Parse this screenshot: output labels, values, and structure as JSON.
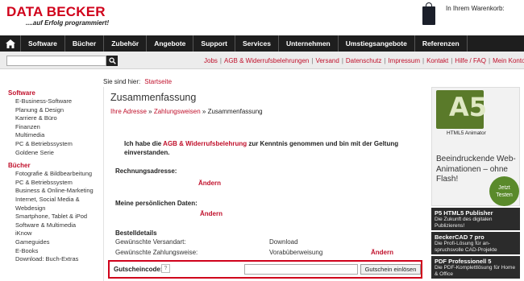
{
  "logo": {
    "brand": "DATA BECKER",
    "tagline": "....auf Erfolg programmiert!"
  },
  "cart": {
    "label": "In Ihrem Warenkorb:"
  },
  "nav": {
    "items": [
      "Software",
      "Bücher",
      "Zubehör",
      "Angebote",
      "Support",
      "Services",
      "Unternehmen",
      "Umstiegsangebote",
      "Referenzen"
    ]
  },
  "search": {
    "placeholder": ""
  },
  "util_links": [
    "Jobs",
    "AGB & Widerrufsbelehrungen",
    "Versand",
    "Datenschutz",
    "Impressum",
    "Kontakt",
    "Hilfe / FAQ",
    "Mein Konto"
  ],
  "breadcrumb": {
    "prefix": "Sie sind hier:",
    "link": "Startseite"
  },
  "sidebar": {
    "software_head": "Software",
    "software_items": [
      "E-Business-Software",
      "Planung & Design",
      "Karriere & Büro",
      "Finanzen",
      "Multimedia",
      "PC & Betriebssystem",
      "Goldene Serie"
    ],
    "books_head": "Bücher",
    "books_items": [
      "Fotografie & Bildbearbeitung",
      "PC & Betriebssystem",
      "Business & Online-Marketing",
      "Internet, Social Media &",
      "Webdesign",
      "Smartphone, Tablet & iPod",
      "Software & Multimedia",
      "iKnow",
      "Gameguides",
      "E-Books",
      "Download: Buch-Extras"
    ]
  },
  "main": {
    "title": "Zusammenfassung",
    "steps": {
      "step1": "Ihre Adresse",
      "step2": "Zahlungsweisen",
      "step3": "Zusammenfassung",
      "sep": "»"
    },
    "agb": {
      "before": "Ich habe die ",
      "link": "AGB & Widerrufsbelehrung",
      "after": " zur Kenntnis genommen und bin mit der Geltung einverstanden."
    },
    "billing_label": "Rechnungsadresse:",
    "billing_change": "Ändern",
    "personal_label": "Meine persönlichen Daten:",
    "personal_change": "Ändern",
    "order_details_label": "Bestelldetails",
    "shipping_label": "Gewünschte Versandart:",
    "shipping_value": "Download",
    "payment_label": "Gewünschte Zahlungsweise:",
    "payment_value": "Vorabüberweisung",
    "payment_change": "Ändern",
    "coupon": {
      "label": "Gutscheincode:",
      "help": "?",
      "button": "Gutschein einlösen",
      "value": ""
    }
  },
  "right": {
    "a5": {
      "logo": "A5",
      "label": "HTML5 Animator",
      "desc": "Beeindruckende Web-Animationen – ohne Flash!",
      "badge": "Jetzt Testen"
    },
    "ads": [
      {
        "title": "P5 HTML5 Publisher",
        "sub": "Die Zukunft des digitalen Publizierens!"
      },
      {
        "title": "BeckerCAD 7 pro",
        "sub": "Die Profi-Lösung für an-spruchsvolle CAD-Projekte"
      },
      {
        "title": "PDF Professionell 5",
        "sub": "Die PDF-Komplettlösung für Home & Office"
      }
    ]
  },
  "colors": {
    "brand_red": "#d0021b",
    "nav_bg": "#1e1e1e",
    "link_red": "#c0102b"
  }
}
